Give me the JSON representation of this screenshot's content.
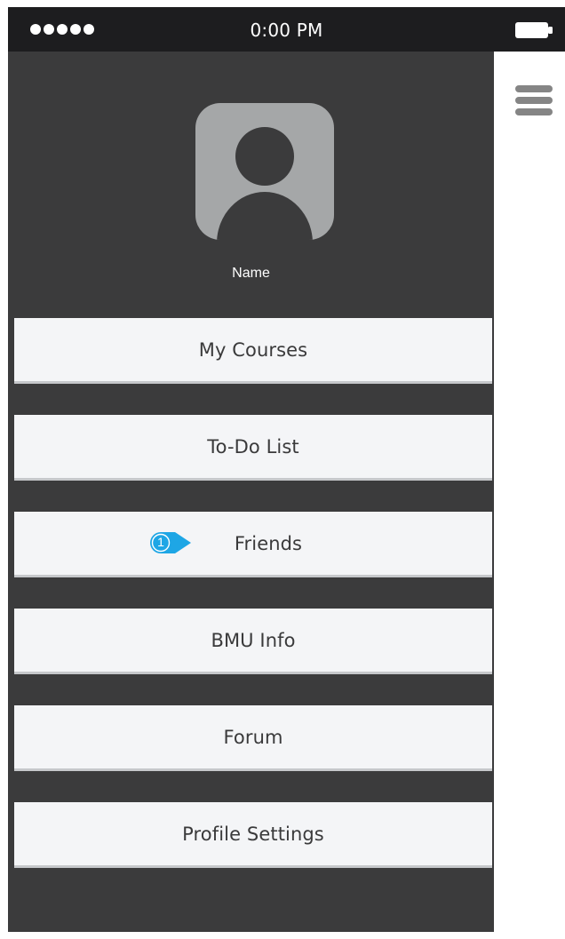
{
  "status_bar": {
    "time": "0:00 PM",
    "signal_bars": 5,
    "signal_icon": "signal-dots",
    "battery_icon": "battery-icon"
  },
  "profile": {
    "avatar_icon": "person-icon",
    "name": "Name"
  },
  "menu": {
    "items": [
      {
        "label": "My Courses"
      },
      {
        "label": "To-Do List"
      },
      {
        "label": "Friends",
        "hint_number": "1"
      },
      {
        "label": "BMU Info"
      },
      {
        "label": "Forum"
      },
      {
        "label": "Profile Settings"
      }
    ]
  },
  "header": {
    "menu_icon": "hamburger-icon"
  },
  "colors": {
    "drawer_background": "#3b3b3c",
    "status_bar_background": "#1d1d1f",
    "menu_item_background": "#f4f5f7",
    "menu_text": "#3a3a3b",
    "avatar_background": "#a5a7a8",
    "hint_accent": "#1ea6e5",
    "hamburger": "#858585"
  }
}
